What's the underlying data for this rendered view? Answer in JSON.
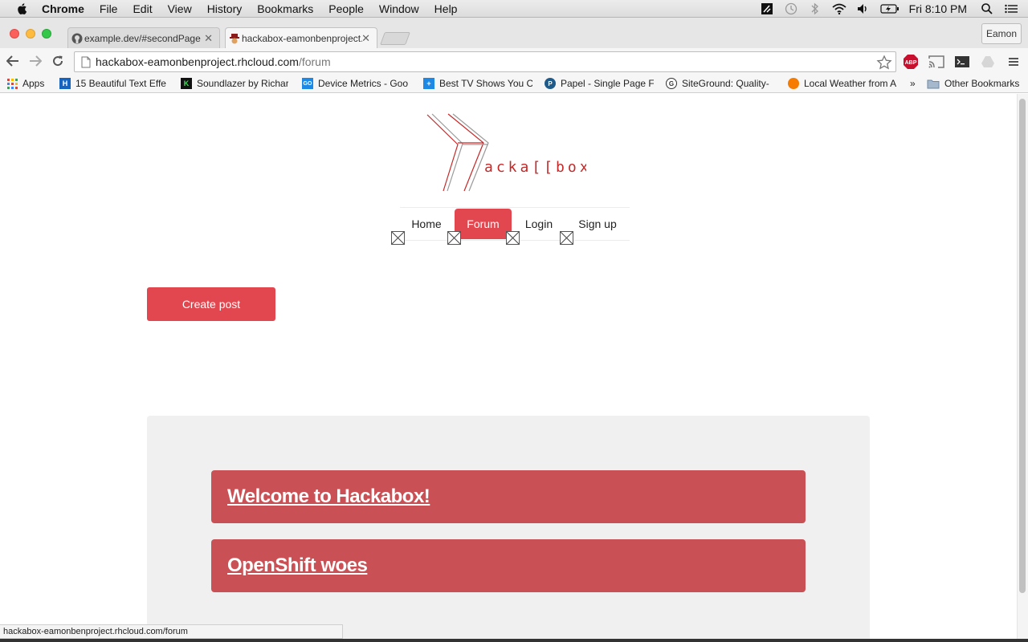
{
  "menubar": {
    "app_name": "Chrome",
    "menus": [
      "File",
      "Edit",
      "View",
      "History",
      "Bookmarks",
      "People",
      "Window",
      "Help"
    ],
    "clock": "Fri 8:10 PM"
  },
  "browser": {
    "tabs": [
      {
        "title": "example.dev/#secondPage",
        "active": false
      },
      {
        "title": "hackabox-eamonbenproject.rhcloud.com/forum",
        "active": true
      }
    ],
    "profile_name": "Eamon",
    "url_host": "hackabox-eamonbenproject.rhcloud.com",
    "url_path": "/forum",
    "bookmarks": [
      {
        "label": "Apps",
        "icon": "apps-grid-icon"
      },
      {
        "label": "15 Beautiful Text Effe",
        "icon": "h-icon"
      },
      {
        "label": "Soundlazer by Richar",
        "icon": "k-icon"
      },
      {
        "label": "Device Metrics - Goo",
        "icon": "go-icon"
      },
      {
        "label": "Best TV Shows You C",
        "icon": "plus-icon"
      },
      {
        "label": "Papel - Single Page F",
        "icon": "papel-icon"
      },
      {
        "label": "SiteGround: Quality-",
        "icon": "siteground-icon"
      },
      {
        "label": "Local Weather from A",
        "icon": "weather-icon"
      },
      {
        "label": "»",
        "icon": ""
      },
      {
        "label": "Other Bookmarks",
        "icon": "folder-icon"
      }
    ],
    "status_url": "hackabox-eamonbenproject.rhcloud.com/forum"
  },
  "site": {
    "logo_text": "acka[[box]]",
    "nav": [
      {
        "label": "Home",
        "active": false
      },
      {
        "label": "Forum",
        "active": true
      },
      {
        "label": "Login",
        "active": false
      },
      {
        "label": "Sign up",
        "active": false
      }
    ],
    "create_post_label": "Create post",
    "posts": [
      {
        "title": "Welcome to Hackabox!"
      },
      {
        "title": "OpenShift woes"
      }
    ]
  },
  "colors": {
    "accent": "#e2474f",
    "post_card": "#c95155",
    "panel": "#f0f0f0"
  }
}
